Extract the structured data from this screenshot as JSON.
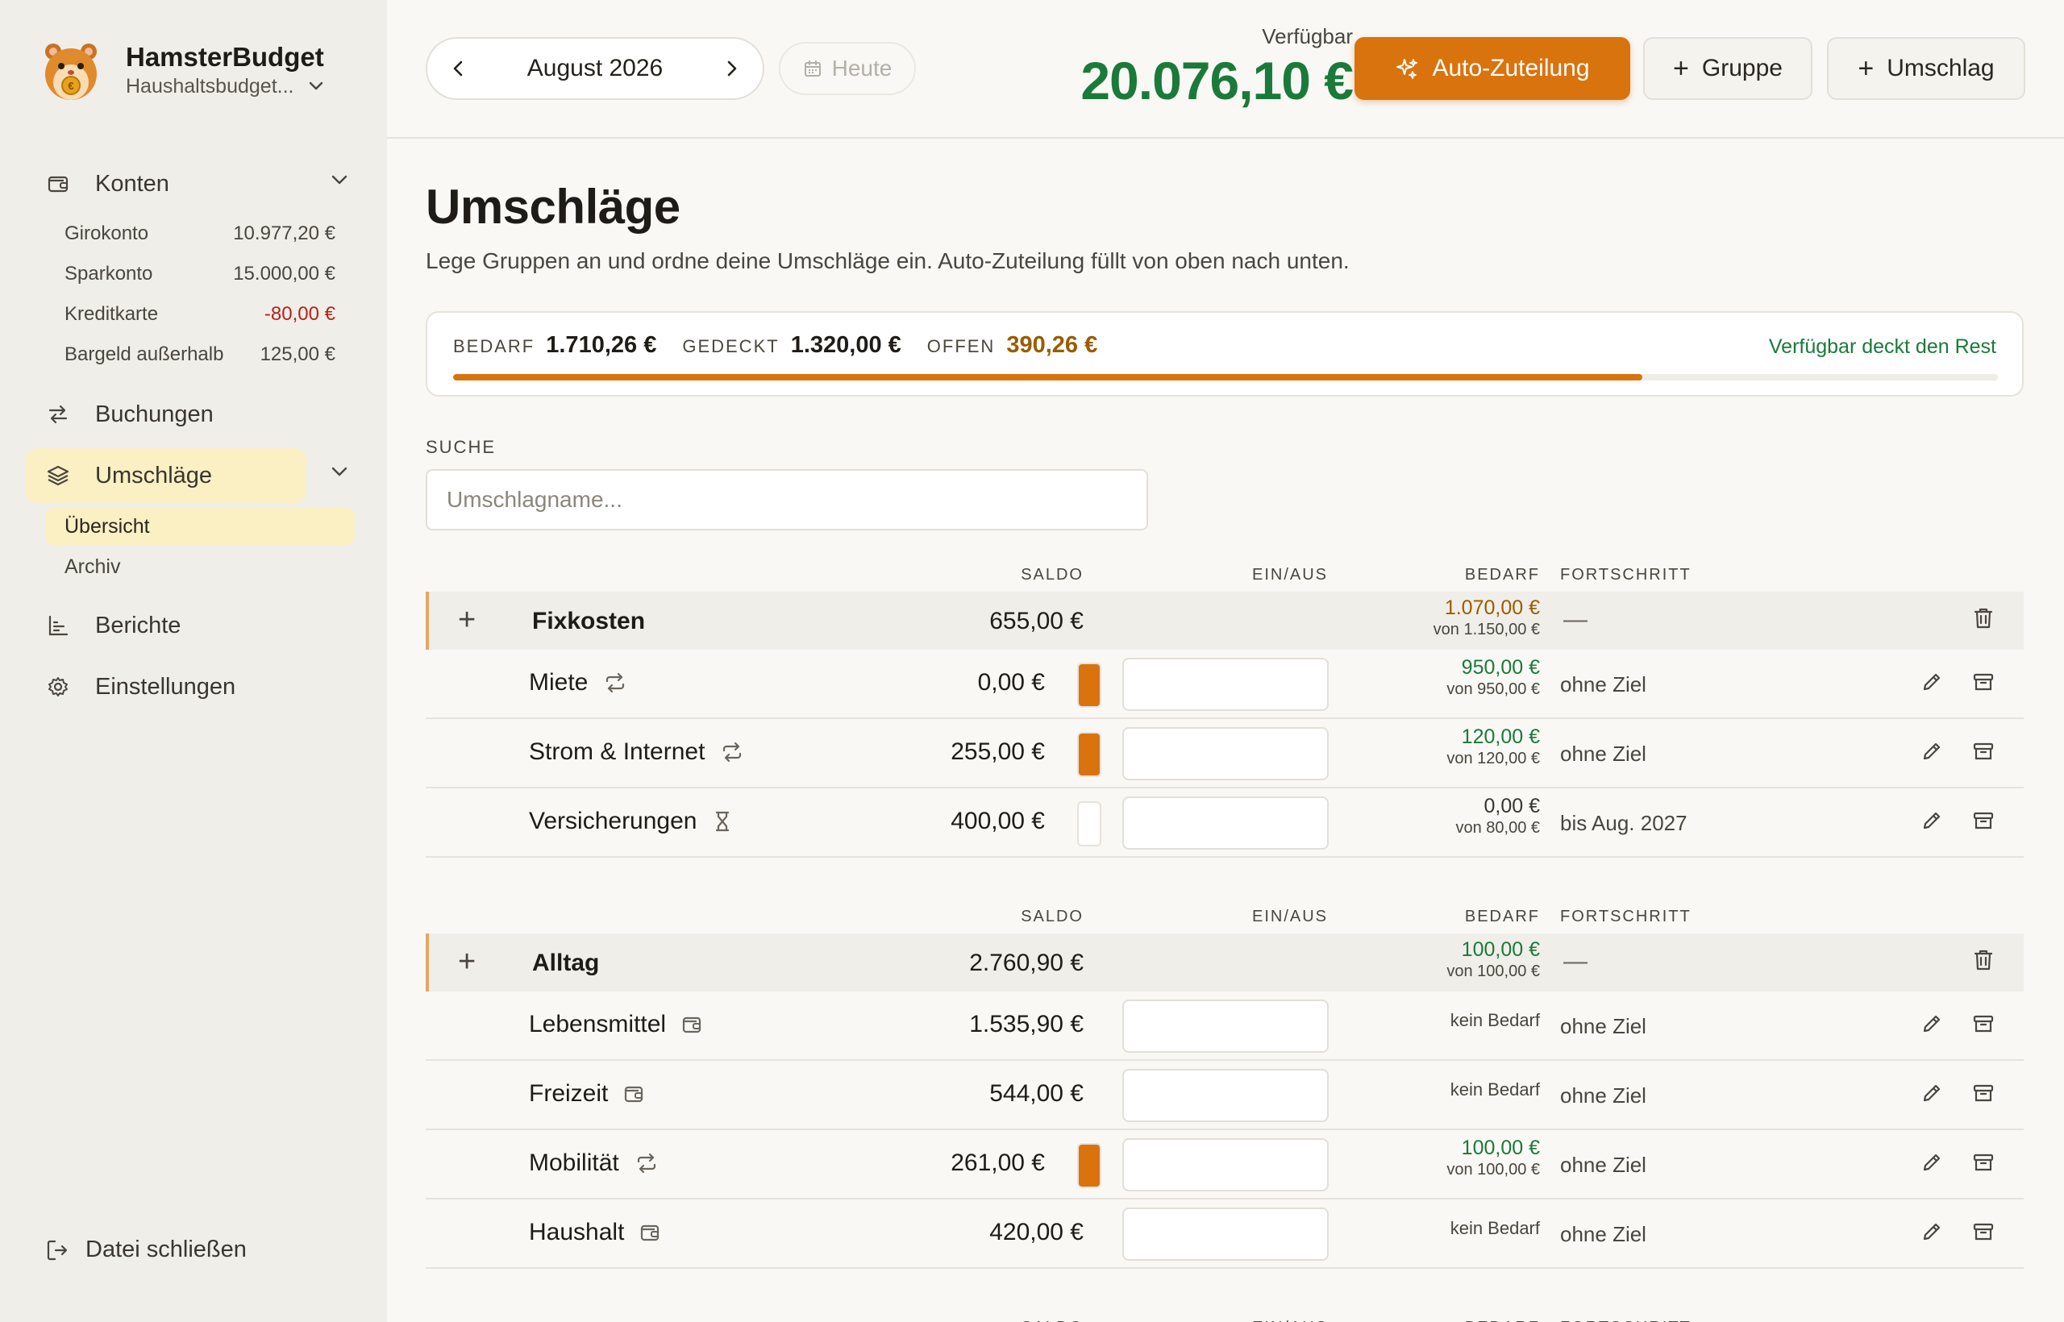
{
  "app": {
    "title": "HamsterBudget",
    "subtitle": "Haushaltsbudget..."
  },
  "sidebar": {
    "konten_label": "Konten",
    "accounts": [
      {
        "name": "Girokonto",
        "balance": "10.977,20 €"
      },
      {
        "name": "Sparkonto",
        "balance": "15.000,00 €"
      },
      {
        "name": "Kreditkarte",
        "balance": "-80,00 €"
      },
      {
        "name": "Bargeld außerhalb",
        "balance": "125,00 €"
      }
    ],
    "buchungen_label": "Buchungen",
    "umschlaege_label": "Umschläge",
    "sub_uebersicht": "Übersicht",
    "sub_archiv": "Archiv",
    "berichte_label": "Berichte",
    "einstellungen_label": "Einstellungen",
    "logout_label": "Datei schließen"
  },
  "topbar": {
    "month": "August 2026",
    "today": "Heute",
    "available_label": "Verfügbar",
    "available_amount": "20.076,10 €",
    "auto_btn": "Auto-Zuteilung",
    "group_btn": "Gruppe",
    "envelope_btn": "Umschlag"
  },
  "main": {
    "title": "Umschläge",
    "subtitle": "Lege Gruppen an und ordne deine Umschläge ein. Auto-Zuteilung füllt von oben nach unten.",
    "summary": {
      "bedarf_label": "BEDARF",
      "bedarf": "1.710,26 €",
      "gedeckt_label": "GEDECKT",
      "gedeckt": "1.320,00 €",
      "offen_label": "OFFEN",
      "offen": "390,26 €",
      "status": "Verfügbar deckt den Rest",
      "progress": 0.77
    },
    "search_label": "SUCHE",
    "search_placeholder": "Umschlagname..."
  },
  "columns": {
    "saldo": "SALDO",
    "einaus": "EIN/AUS",
    "bedarf": "BEDARF",
    "fortschritt": "FORTSCHRITT"
  },
  "groups": [
    {
      "name": "Fixkosten",
      "saldo": "655,00 €",
      "bedarf": "1.070,00 €",
      "bedarf_von": "von 1.150,00 €",
      "progress": "—",
      "envelopes": [
        {
          "name": "Miete",
          "icon": "repeat-icon",
          "saldo": "0,00 €",
          "fill": 1.0,
          "bedarf": "950,00 €",
          "bedarf_von": "von 950,00 €",
          "progress": "ohne Ziel"
        },
        {
          "name": "Strom & Internet",
          "icon": "repeat-icon",
          "saldo": "255,00 €",
          "fill": 1.0,
          "bedarf": "120,00 €",
          "bedarf_von": "von 120,00 €",
          "progress": "ohne Ziel"
        },
        {
          "name": "Versicherungen",
          "icon": "hourglass-icon",
          "saldo": "400,00 €",
          "fill": 0.0,
          "bedarf": "0,00 €",
          "bedarf_von": "von 80,00 €",
          "progress": "bis Aug. 2027"
        }
      ]
    },
    {
      "name": "Alltag",
      "saldo": "2.760,90 €",
      "bedarf": "100,00 €",
      "bedarf_von": "von 100,00 €",
      "progress": "—",
      "envelopes": [
        {
          "name": "Lebensmittel",
          "icon": "wallet-icon",
          "saldo": "1.535,90 €",
          "bedarf_none": "kein Bedarf",
          "progress": "ohne Ziel"
        },
        {
          "name": "Freizeit",
          "icon": "wallet-icon",
          "saldo": "544,00 €",
          "bedarf_none": "kein Bedarf",
          "progress": "ohne Ziel"
        },
        {
          "name": "Mobilität",
          "icon": "repeat-icon",
          "saldo": "261,00 €",
          "fill": 1.0,
          "bedarf": "100,00 €",
          "bedarf_von": "von 100,00 €",
          "progress": "ohne Ziel"
        },
        {
          "name": "Haushalt",
          "icon": "wallet-icon",
          "saldo": "420,00 €",
          "bedarf_none": "kein Bedarf",
          "progress": "ohne Ziel"
        }
      ]
    }
  ],
  "colors": {
    "accent": "#d9730d",
    "positive": "#1a7a3a",
    "negative": "#b42318",
    "warning": "#9a5b00",
    "active_bg": "#fbefc4"
  }
}
